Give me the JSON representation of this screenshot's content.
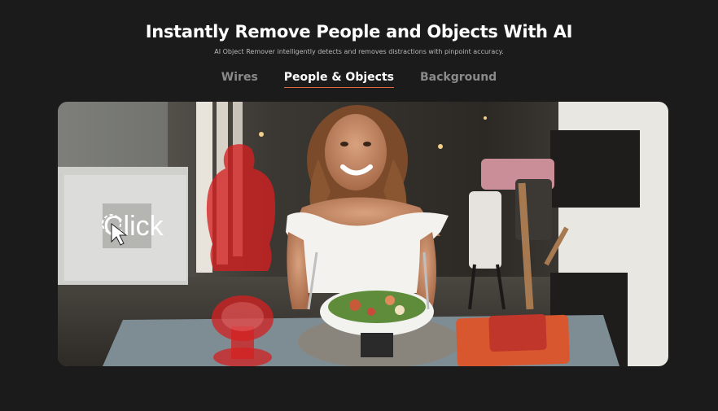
{
  "header": {
    "title": "Instantly Remove People and Objects With AI",
    "subtitle": "AI Object Remover intelligently detects and removes distractions with pinpoint accuracy."
  },
  "tabs": [
    {
      "label": "Wires",
      "active": false
    },
    {
      "label": "People & Objects",
      "active": true
    },
    {
      "label": "Background",
      "active": false
    }
  ],
  "demo": {
    "click_label": "Click",
    "icon": "cursor-click-icon",
    "mask_color": "#d42020",
    "accent_color": "#e06a3a"
  }
}
